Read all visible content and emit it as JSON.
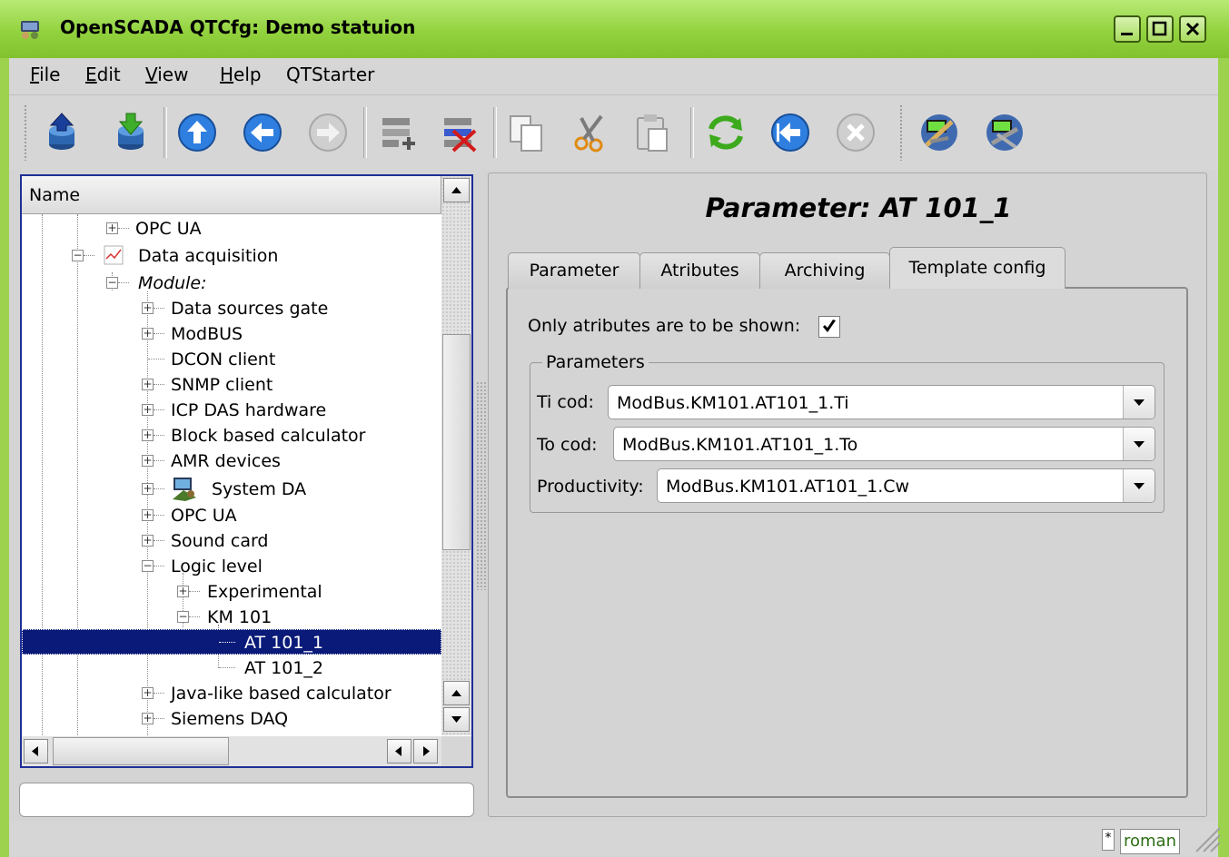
{
  "window": {
    "title": "OpenSCADA QTCfg: Demo statuion"
  },
  "menu": [
    {
      "label": "File",
      "accel": "F",
      "rest": "ile"
    },
    {
      "label": "Edit",
      "accel": "E",
      "rest": "dit"
    },
    {
      "label": "View",
      "accel": "V",
      "rest": "iew"
    },
    {
      "label": "Help",
      "accel": "H",
      "rest": "elp"
    },
    {
      "label": "QTStarter",
      "accel": "",
      "rest": "QTStarter"
    }
  ],
  "toolbar_icons": [
    "db-load-icon",
    "db-save-icon",
    "up-icon",
    "back-icon",
    "forward-icon",
    "add-item-icon",
    "delete-item-icon",
    "copy-icon",
    "cut-icon",
    "paste-icon",
    "refresh-icon",
    "start-icon",
    "stop-icon",
    "module-settings-icon",
    "module-settings-2-icon"
  ],
  "tree": {
    "header": "Name",
    "items": [
      {
        "label": "OPC UA",
        "expander": "+"
      },
      {
        "label": "Data acquisition",
        "expander": "-"
      },
      {
        "label": "Module:",
        "expander": "-"
      },
      {
        "label": "Data sources gate",
        "expander": "+"
      },
      {
        "label": "ModBUS",
        "expander": "+"
      },
      {
        "label": "DCON client",
        "expander": ""
      },
      {
        "label": "SNMP client",
        "expander": "+"
      },
      {
        "label": "ICP DAS hardware",
        "expander": "+"
      },
      {
        "label": "Block based calculator",
        "expander": "+"
      },
      {
        "label": "AMR devices",
        "expander": "+"
      },
      {
        "label": "System DA",
        "expander": "+"
      },
      {
        "label": "OPC UA",
        "expander": "+"
      },
      {
        "label": "Sound card",
        "expander": "+"
      },
      {
        "label": "Logic level",
        "expander": "-"
      },
      {
        "label": "Experimental",
        "expander": "+"
      },
      {
        "label": "KM 101",
        "expander": "-"
      },
      {
        "label": "AT 101_1",
        "expander": "",
        "selected": true
      },
      {
        "label": "AT 101_2",
        "expander": ""
      },
      {
        "label": "Java-like based calculator",
        "expander": "+"
      },
      {
        "label": "Siemens DAQ",
        "expander": "+"
      }
    ]
  },
  "status_input": {
    "value": ""
  },
  "page": {
    "title": "Parameter: AT 101_1"
  },
  "tabs": [
    {
      "label": "Parameter"
    },
    {
      "label": "Atributes"
    },
    {
      "label": "Archiving"
    },
    {
      "label": "Template config",
      "active": true
    }
  ],
  "template_config": {
    "only_attributes_label": "Only atributes are to be shown:",
    "only_attributes_checked": true,
    "group_label": "Parameters",
    "fields": [
      {
        "label": "Ti cod:",
        "value": "ModBus.KM101.AT101_1.Ti"
      },
      {
        "label": "To cod:",
        "value": "ModBus.KM101.AT101_1.To"
      },
      {
        "label": "Productivity:",
        "value": "ModBus.KM101.AT101_1.Cw"
      }
    ]
  },
  "statusbar": {
    "modified_marker": "*",
    "user": "roman"
  },
  "colors": {
    "titlebar": "#9cd24e",
    "selection": "#0a1a78",
    "tree_border": "#1f2f96",
    "user_text": "#2e6e15"
  }
}
